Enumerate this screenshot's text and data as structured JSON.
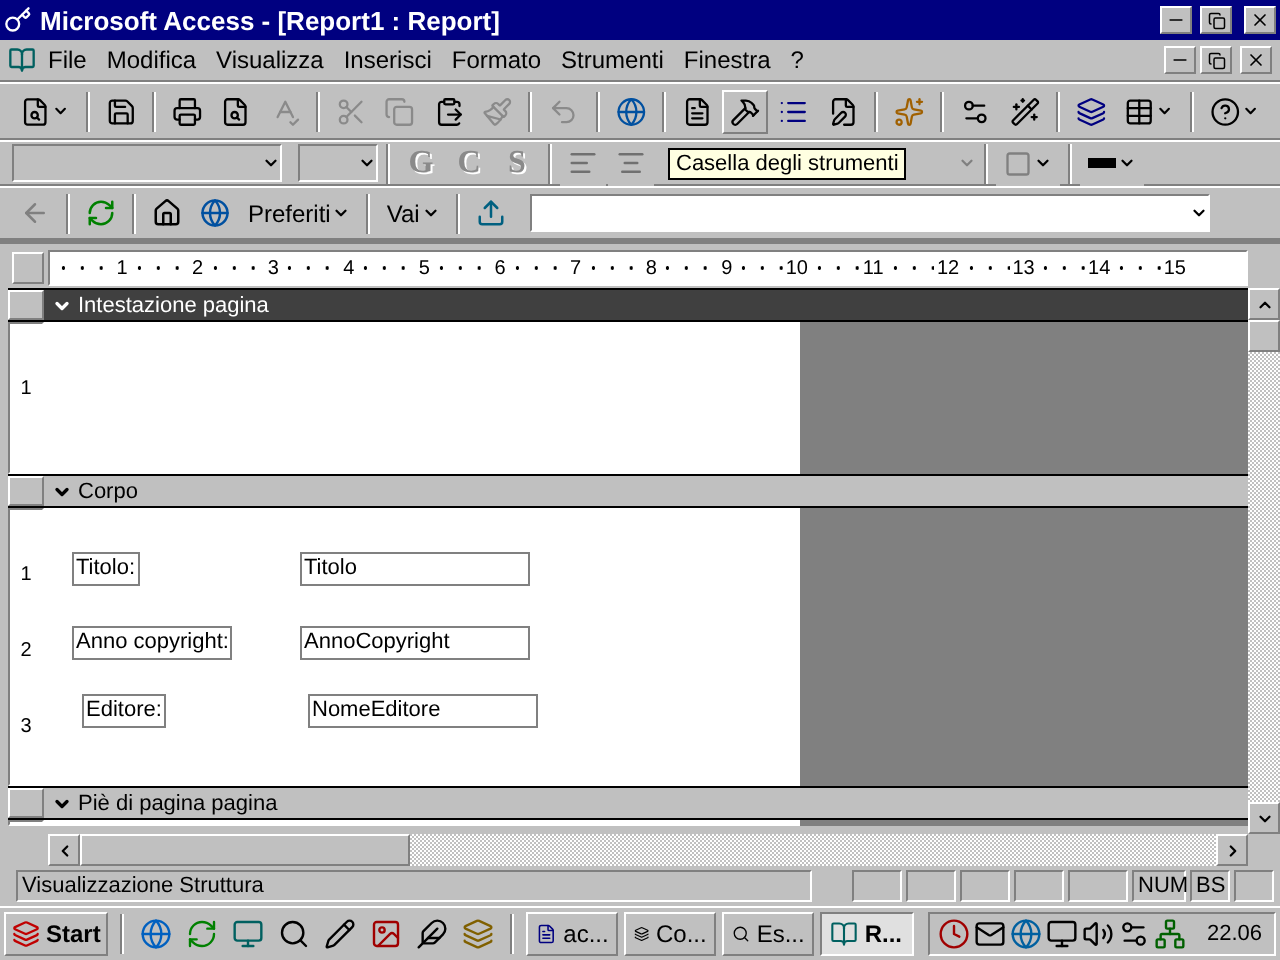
{
  "window": {
    "title": "Microsoft Access - [Report1 : Report]"
  },
  "menu": [
    "File",
    "Modifica",
    "Visualizza",
    "Inserisci",
    "Formato",
    "Strumenti",
    "Finestra",
    "?"
  ],
  "toolbar": [
    {
      "disabled": false,
      "hovered": false
    },
    {
      "disabled": false,
      "hovered": false
    },
    {
      "disabled": false,
      "hovered": false
    },
    {
      "disabled": false,
      "hovered": false
    },
    {
      "disabled": true,
      "hovered": false
    },
    {
      "disabled": true,
      "hovered": false
    },
    {
      "disabled": true,
      "hovered": false
    },
    {
      "disabled": false,
      "hovered": false
    },
    {
      "disabled": true,
      "hovered": false
    },
    {
      "disabled": true,
      "hovered": false
    },
    {
      "disabled": false,
      "hovered": false
    },
    {
      "disabled": false,
      "hovered": false
    },
    {
      "disabled": false,
      "hovered": true
    },
    {
      "disabled": false,
      "hovered": false
    },
    {
      "disabled": false,
      "hovered": false
    },
    {
      "disabled": false,
      "hovered": false
    },
    {
      "disabled": false,
      "hovered": false
    },
    {
      "disabled": false,
      "hovered": false
    },
    {
      "disabled": false,
      "hovered": false
    },
    {
      "disabled": false,
      "hovered": false
    },
    {
      "disabled": false,
      "hovered": false
    }
  ],
  "format_buttons": [
    {
      "label": "G",
      "disabled": true
    },
    {
      "label": "C",
      "disabled": true
    },
    {
      "label": "S",
      "disabled": true
    }
  ],
  "tooltip": "Casella degli strumenti",
  "web_toolbar": {
    "favorites": "Preferiti",
    "go": "Vai"
  },
  "ruler": {
    "horizontal": [
      "1",
      "2",
      "3",
      "4",
      "5",
      "6",
      "7",
      "8",
      "9",
      "10",
      "11",
      "12",
      "13",
      "14",
      "15"
    ]
  },
  "sections": [
    {
      "title": "Intestazione pagina",
      "selected": true,
      "ruler": [
        "1"
      ]
    },
    {
      "title": "Corpo",
      "selected": false,
      "ruler": [
        "1",
        "2",
        "3"
      ],
      "controls": [
        {
          "kind": "label",
          "text": "Titolo:"
        },
        {
          "kind": "textbox",
          "text": "Titolo"
        },
        {
          "kind": "label",
          "text": "Anno copyright:"
        },
        {
          "kind": "textbox",
          "text": "AnnoCopyright"
        },
        {
          "kind": "label",
          "text": "Editore:"
        },
        {
          "kind": "textbox",
          "text": "NomeEditore"
        }
      ]
    },
    {
      "title": "Piè di pagina pagina",
      "selected": false
    }
  ],
  "status_bar": {
    "text": "Visualizzazione Struttura",
    "indicators": [
      "NUM",
      "BS"
    ]
  },
  "taskbar": {
    "start": "Start",
    "tasks": [
      {
        "label": "ac...",
        "selected": false
      },
      {
        "label": "Co...",
        "selected": false
      },
      {
        "label": "Es...",
        "selected": false
      },
      {
        "label": "R...",
        "selected": true
      }
    ],
    "clock": "22.06"
  }
}
